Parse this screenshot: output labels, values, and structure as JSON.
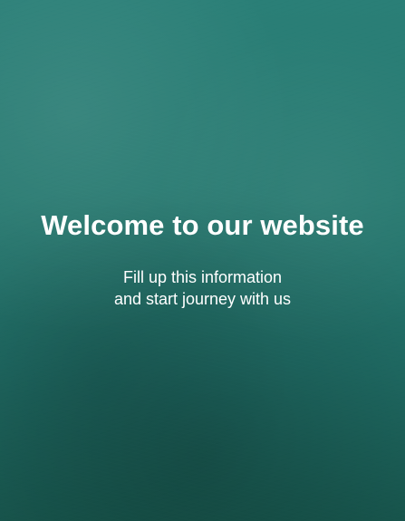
{
  "welcome_panel": {
    "title": "Welcome to our website",
    "subtitle_line_1": "Fill up this information",
    "subtitle_line_2": "and start journey with us",
    "colors": {
      "background_primary": "#287a71",
      "background_dark": "#18584f",
      "text": "#ffffff"
    }
  }
}
